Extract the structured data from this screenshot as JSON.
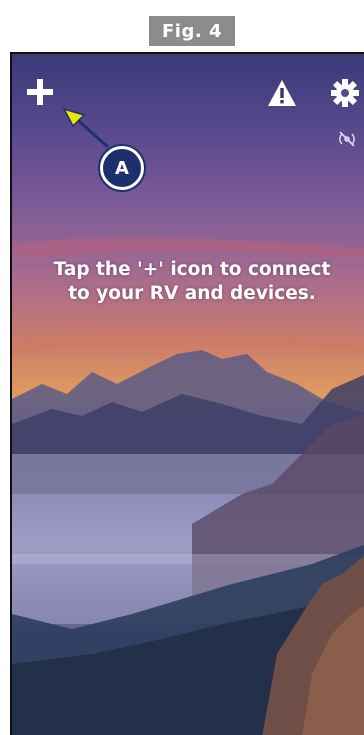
{
  "figure": {
    "label": "Fig. 4"
  },
  "topbar": {
    "add_icon": "plus-icon",
    "warning_icon": "warning-triangle-icon",
    "settings_icon": "gear-icon",
    "connection_icon": "no-connection-icon"
  },
  "main": {
    "hint_text": "Tap the '+' icon to connect to your RV and devices."
  },
  "callout": {
    "label": "A"
  },
  "colors": {
    "callout_badge": "#1e2f6e",
    "callout_arrow": "#e6e600",
    "figure_label_bg": "#8c8c8c"
  }
}
